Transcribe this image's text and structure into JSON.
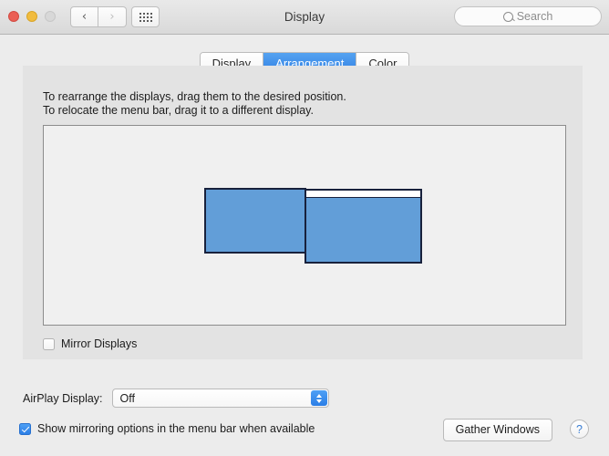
{
  "window": {
    "title": "Display",
    "traffic_lights": [
      {
        "name": "close",
        "color": "#eb5f55"
      },
      {
        "name": "minimize",
        "color": "#f1bc3f"
      },
      {
        "name": "zoom",
        "color": "#d8d8d8"
      }
    ],
    "nav": {
      "back_icon": "chevron-left-icon",
      "forward_icon": "chevron-right-icon",
      "show_all_icon": "grid-icon"
    },
    "search": {
      "placeholder": "Search",
      "icon": "search-icon"
    }
  },
  "tabs": [
    {
      "label": "Display",
      "selected": false
    },
    {
      "label": "Arrangement",
      "selected": true
    },
    {
      "label": "Color",
      "selected": false
    }
  ],
  "panel": {
    "instruction_line1": "To rearrange the displays, drag them to the desired position.",
    "instruction_line2": "To relocate the menu bar, drag it to a different display.",
    "displays": [
      {
        "name": "display-left",
        "has_menu_bar": false
      },
      {
        "name": "display-right",
        "has_menu_bar": true
      }
    ],
    "mirror_displays": {
      "label": "Mirror Displays",
      "checked": false
    }
  },
  "bottom": {
    "airplay_label": "AirPlay Display:",
    "airplay_value": "Off",
    "show_mirroring": {
      "label": "Show mirroring options in the menu bar when available",
      "checked": true
    },
    "gather_windows_label": "Gather Windows",
    "help_label": "?"
  },
  "colors": {
    "accent": "#2f7fe4",
    "display_fill": "#629ed8",
    "display_border": "#18213c"
  }
}
